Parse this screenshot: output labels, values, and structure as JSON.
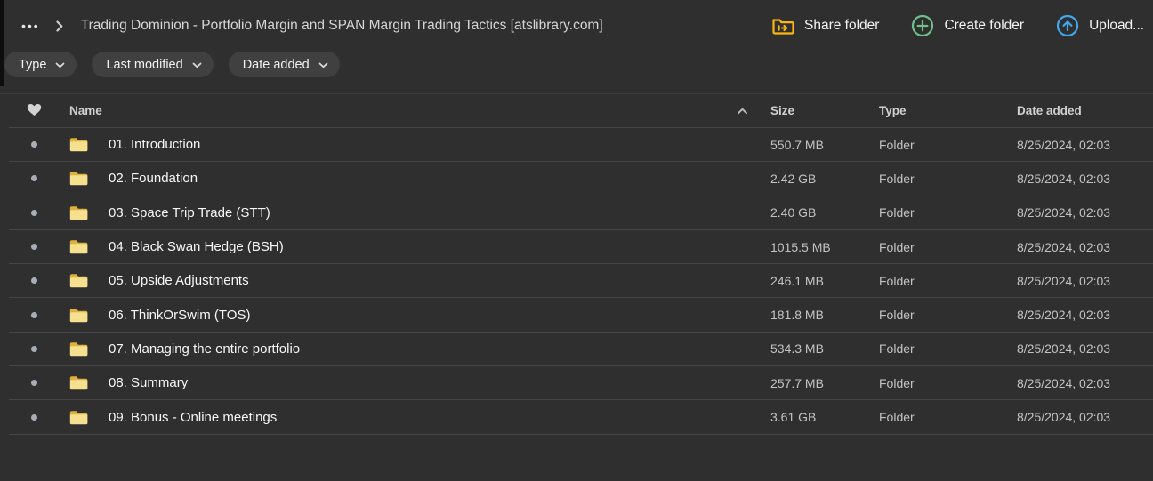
{
  "topbar": {
    "menu_button": "•••",
    "breadcrumb": {
      "title": "Trading Dominion - Portfolio Margin and SPAN Margin Trading Tactics [atslibrary.com]"
    },
    "actions": [
      {
        "label": "Share folder",
        "icon": "share-folder-icon",
        "color": "#fbb612"
      },
      {
        "label": "Create folder",
        "icon": "create-folder-icon",
        "color": "#6fc08d"
      },
      {
        "label": "Upload...",
        "icon": "upload-icon",
        "color": "#41a7ee"
      }
    ]
  },
  "filters": [
    {
      "label": "Type",
      "icon": "chevron-down-icon"
    },
    {
      "label": "Last modified",
      "icon": "chevron-down-icon"
    },
    {
      "label": "Date added",
      "icon": "chevron-down-icon"
    }
  ],
  "table": {
    "headers": {
      "favorite": "heart-icon",
      "name": "Name",
      "size": "Size",
      "type": "Type",
      "date_added": "Date added"
    },
    "sort": {
      "column": "Name",
      "direction": "ascending",
      "icon": "chevron-up-icon"
    },
    "row_icon": "folder-icon",
    "rows": [
      {
        "name": "01. Introduction",
        "size": "550.7 MB",
        "type": "Folder",
        "date_added": "8/25/2024, 02:03"
      },
      {
        "name": "02. Foundation",
        "size": "2.42 GB",
        "type": "Folder",
        "date_added": "8/25/2024, 02:03"
      },
      {
        "name": "03. Space Trip Trade (STT)",
        "size": "2.40 GB",
        "type": "Folder",
        "date_added": "8/25/2024, 02:03"
      },
      {
        "name": "04. Black Swan Hedge (BSH)",
        "size": "1015.5 MB",
        "type": "Folder",
        "date_added": "8/25/2024, 02:03"
      },
      {
        "name": "05. Upside Adjustments",
        "size": "246.1 MB",
        "type": "Folder",
        "date_added": "8/25/2024, 02:03"
      },
      {
        "name": "06. ThinkOrSwim (TOS)",
        "size": "181.8 MB",
        "type": "Folder",
        "date_added": "8/25/2024, 02:03"
      },
      {
        "name": "07. Managing the entire portfolio",
        "size": "534.3 MB",
        "type": "Folder",
        "date_added": "8/25/2024, 02:03"
      },
      {
        "name": "08. Summary",
        "size": "257.7 MB",
        "type": "Folder",
        "date_added": "8/25/2024, 02:03"
      },
      {
        "name": "09. Bonus - Online meetings",
        "size": "3.61 GB",
        "type": "Folder",
        "date_added": "8/25/2024, 02:03"
      }
    ]
  },
  "colors": {
    "background": "#2f2f2f",
    "pill_background": "#404040",
    "row_separator": "#454545",
    "share_accent": "#fbb612",
    "create_accent": "#6fc08d",
    "upload_accent": "#41a7ee",
    "folder_body": "#f4e08f",
    "folder_tab": "#ddb13f"
  }
}
